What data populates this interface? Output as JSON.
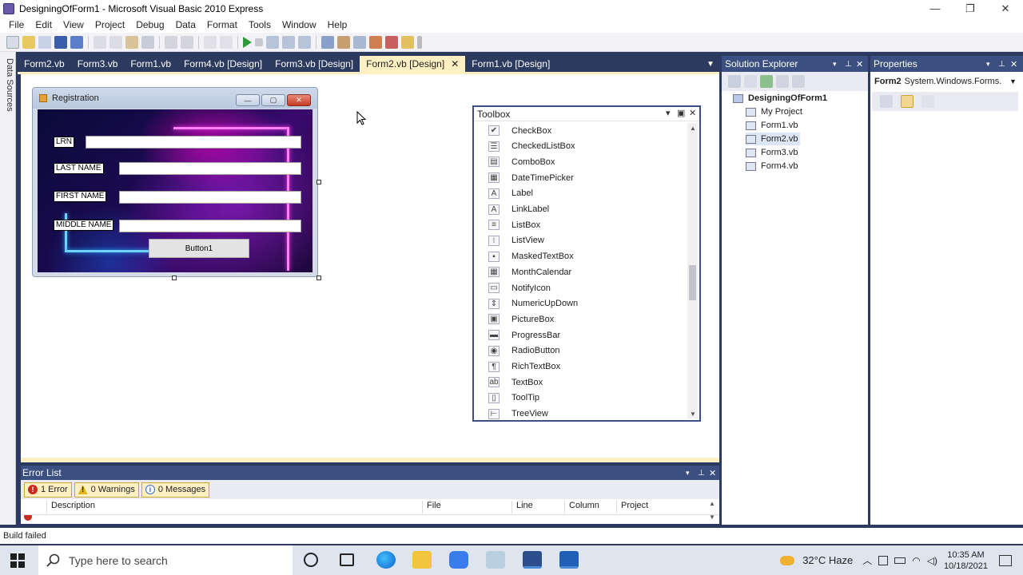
{
  "window": {
    "title": "DesigningOfForm1 - Microsoft Visual Basic 2010 Express",
    "buttons": {
      "minimize": "—",
      "restore": "❐",
      "close": "✕"
    }
  },
  "menu": [
    "File",
    "Edit",
    "View",
    "Project",
    "Debug",
    "Data",
    "Format",
    "Tools",
    "Window",
    "Help"
  ],
  "left_strip": {
    "label": "Data Sources"
  },
  "doc_tabs": [
    {
      "label": "Form2.vb",
      "active": false
    },
    {
      "label": "Form3.vb",
      "active": false
    },
    {
      "label": "Form1.vb",
      "active": false
    },
    {
      "label": "Form4.vb [Design]",
      "active": false
    },
    {
      "label": "Form3.vb [Design]",
      "active": false
    },
    {
      "label": "Form2.vb [Design]",
      "active": true
    },
    {
      "label": "Form1.vb [Design]",
      "active": false
    }
  ],
  "registration_form": {
    "title": "Registration",
    "fields": [
      {
        "label": "LRN",
        "value": ""
      },
      {
        "label": "LAST NAME",
        "value": ""
      },
      {
        "label": "FIRST NAME",
        "value": ""
      },
      {
        "label": "MIDDLE NAME",
        "value": ""
      }
    ],
    "button_label": "Button1"
  },
  "toolbox": {
    "title": "Toolbox",
    "items": [
      {
        "label": "CheckBox",
        "icon": "checkbox-icon",
        "glyph": "✔"
      },
      {
        "label": "CheckedListBox",
        "icon": "checkedlistbox-icon",
        "glyph": "☰"
      },
      {
        "label": "ComboBox",
        "icon": "combobox-icon",
        "glyph": "▤"
      },
      {
        "label": "DateTimePicker",
        "icon": "datetimepicker-icon",
        "glyph": "▦"
      },
      {
        "label": "Label",
        "icon": "label-icon",
        "glyph": "A"
      },
      {
        "label": "LinkLabel",
        "icon": "linklabel-icon",
        "glyph": "A"
      },
      {
        "label": "ListBox",
        "icon": "listbox-icon",
        "glyph": "≡"
      },
      {
        "label": "ListView",
        "icon": "listview-icon",
        "glyph": "⁝"
      },
      {
        "label": "MaskedTextBox",
        "icon": "maskedtextbox-icon",
        "glyph": "▪"
      },
      {
        "label": "MonthCalendar",
        "icon": "monthcalendar-icon",
        "glyph": "▦"
      },
      {
        "label": "NotifyIcon",
        "icon": "notifyicon-icon",
        "glyph": "▭"
      },
      {
        "label": "NumericUpDown",
        "icon": "numericupdown-icon",
        "glyph": "⇕"
      },
      {
        "label": "PictureBox",
        "icon": "picturebox-icon",
        "glyph": "▣"
      },
      {
        "label": "ProgressBar",
        "icon": "progressbar-icon",
        "glyph": "▬"
      },
      {
        "label": "RadioButton",
        "icon": "radiobutton-icon",
        "glyph": "◉"
      },
      {
        "label": "RichTextBox",
        "icon": "richtextbox-icon",
        "glyph": "¶"
      },
      {
        "label": "TextBox",
        "icon": "textbox-icon",
        "glyph": "ab"
      },
      {
        "label": "ToolTip",
        "icon": "tooltip-icon",
        "glyph": "▯"
      },
      {
        "label": "TreeView",
        "icon": "treeview-icon",
        "glyph": "⊢"
      }
    ]
  },
  "solution_explorer": {
    "title": "Solution Explorer",
    "root": "DesigningOfForm1",
    "items": [
      "My Project",
      "Form1.vb",
      "Form2.vb",
      "Form3.vb",
      "Form4.vb"
    ],
    "selected": "Form2.vb"
  },
  "properties": {
    "title": "Properties",
    "object_name": "Form2",
    "object_type": "System.Windows.Forms."
  },
  "error_list": {
    "title": "Error List",
    "errors_btn": "1 Error",
    "warnings_btn": "0 Warnings",
    "messages_btn": "0 Messages",
    "columns": [
      "Description",
      "File",
      "Line",
      "Column",
      "Project"
    ]
  },
  "status": {
    "text": "Build failed"
  },
  "taskbar": {
    "search_placeholder": "Type here to search",
    "weather": "32°C  Haze",
    "time": "10:35 AM",
    "date": "10/18/2021"
  },
  "colors": {
    "ide_frame": "#2b3a5e",
    "panel_header": "#3b4f81",
    "active_tab": "#fff0c4",
    "error_red": "#cc2a1f",
    "warning_yellow": "#e0b81e"
  }
}
